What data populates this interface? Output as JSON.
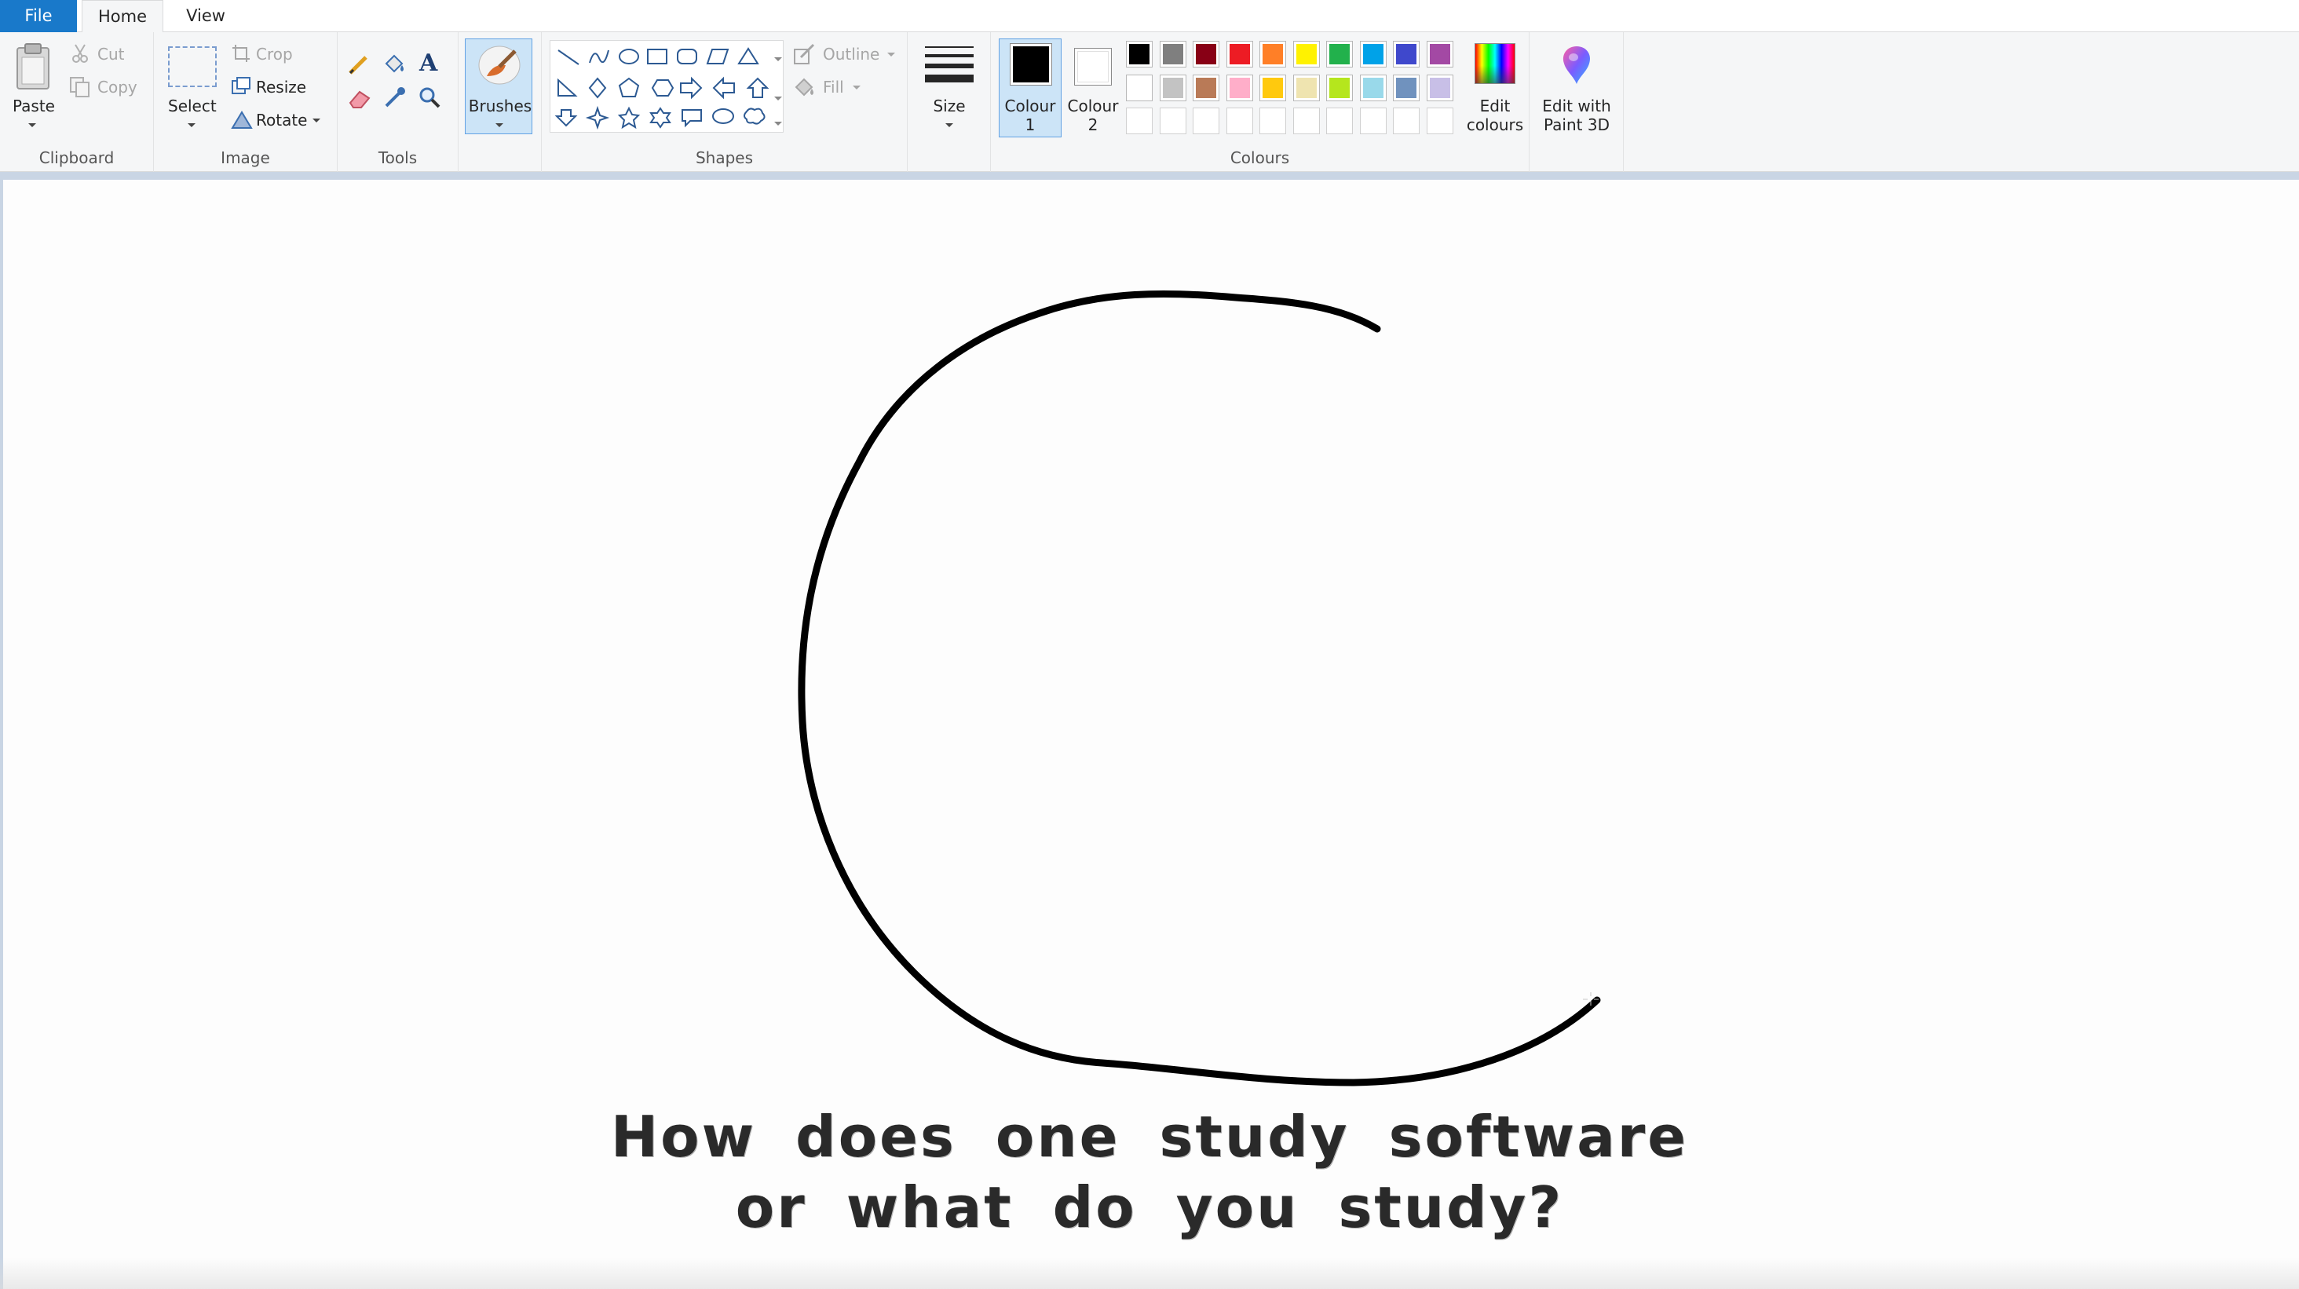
{
  "tabs": {
    "file": "File",
    "home": "Home",
    "view": "View"
  },
  "clipboard": {
    "label": "Clipboard",
    "paste": "Paste",
    "cut": "Cut",
    "copy": "Copy"
  },
  "image": {
    "label": "Image",
    "select": "Select",
    "crop": "Crop",
    "resize": "Resize",
    "rotate": "Rotate"
  },
  "tools": {
    "label": "Tools"
  },
  "brushes": {
    "label": "Brushes"
  },
  "shapes": {
    "label": "Shapes",
    "outline": "Outline",
    "fill": "Fill"
  },
  "size": {
    "label": "Size"
  },
  "colours": {
    "label": "Colours",
    "colour1_line1": "Colour",
    "colour1_line2": "1",
    "colour2_line1": "Colour",
    "colour2_line2": "2",
    "colour1_value": "#000000",
    "colour2_value": "#ffffff",
    "edit_line1": "Edit",
    "edit_line2": "colours",
    "palette_row1": [
      "#000000",
      "#7f7f7f",
      "#880015",
      "#ed1c24",
      "#ff7f27",
      "#fff200",
      "#22b14c",
      "#00a2e8",
      "#3f48cc",
      "#a349a4"
    ],
    "palette_row2": [
      "#ffffff",
      "#c3c3c3",
      "#b97a57",
      "#ffaec9",
      "#ffc90e",
      "#efe4b0",
      "#b5e61d",
      "#99d9ea",
      "#7092be",
      "#c8bfe7"
    ]
  },
  "paint3d": {
    "line1": "Edit with",
    "line2": "Paint 3D"
  },
  "canvas": {
    "caption_line1": "How does one study software",
    "caption_line2": "or what do you study?"
  }
}
